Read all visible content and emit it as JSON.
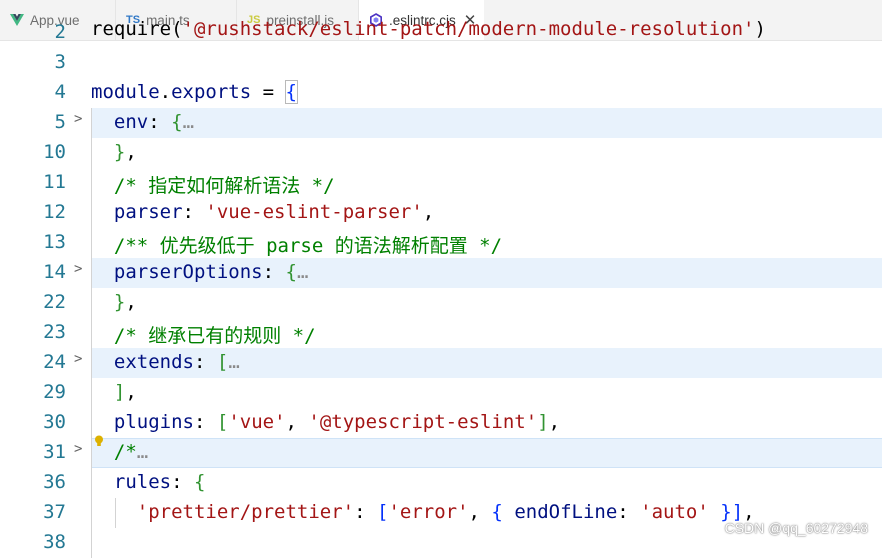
{
  "tabs": [
    {
      "label": "App.vue",
      "icon": "vue-icon"
    },
    {
      "label": "main.ts",
      "icon": "TS"
    },
    {
      "label": "preinstall.js",
      "icon": "JS"
    },
    {
      "label": ".eslintrc.cjs",
      "icon": "eslint-icon",
      "active": true,
      "close": "✕"
    }
  ],
  "lines": [
    {
      "num": "2",
      "text": "require('@rushstack/eslint-patch/modern-module-resolution')"
    },
    {
      "num": "3",
      "text": ""
    },
    {
      "num": "4",
      "text": "module.exports = {"
    },
    {
      "num": "5",
      "text": "env: {…",
      "folded": true
    },
    {
      "num": "10",
      "text": "},"
    },
    {
      "num": "11",
      "text": "/* 指定如何解析语法 */"
    },
    {
      "num": "12",
      "text": "parser: 'vue-eslint-parser',"
    },
    {
      "num": "13",
      "text": "/** 优先级低于 parse 的语法解析配置 */"
    },
    {
      "num": "14",
      "text": "parserOptions: {…",
      "folded": true
    },
    {
      "num": "22",
      "text": "},"
    },
    {
      "num": "23",
      "text": "/* 继承已有的规则 */"
    },
    {
      "num": "24",
      "text": "extends: […",
      "folded": true
    },
    {
      "num": "29",
      "text": "],"
    },
    {
      "num": "30",
      "text": "plugins: ['vue', '@typescript-eslint'],"
    },
    {
      "num": "31",
      "text": "/*…",
      "folded": true
    },
    {
      "num": "36",
      "text": "rules: {"
    },
    {
      "num": "37",
      "text": "'prettier/prettier': ['error', { endOfLine: 'auto' }],"
    },
    {
      "num": "38",
      "text": ""
    }
  ],
  "watermark": "CSDN @qq_60272948",
  "colors": {
    "key": "#001080",
    "string": "#a31515",
    "comment": "#008000",
    "line_number": "#237893",
    "fold_highlight": "#e8f2fc"
  }
}
